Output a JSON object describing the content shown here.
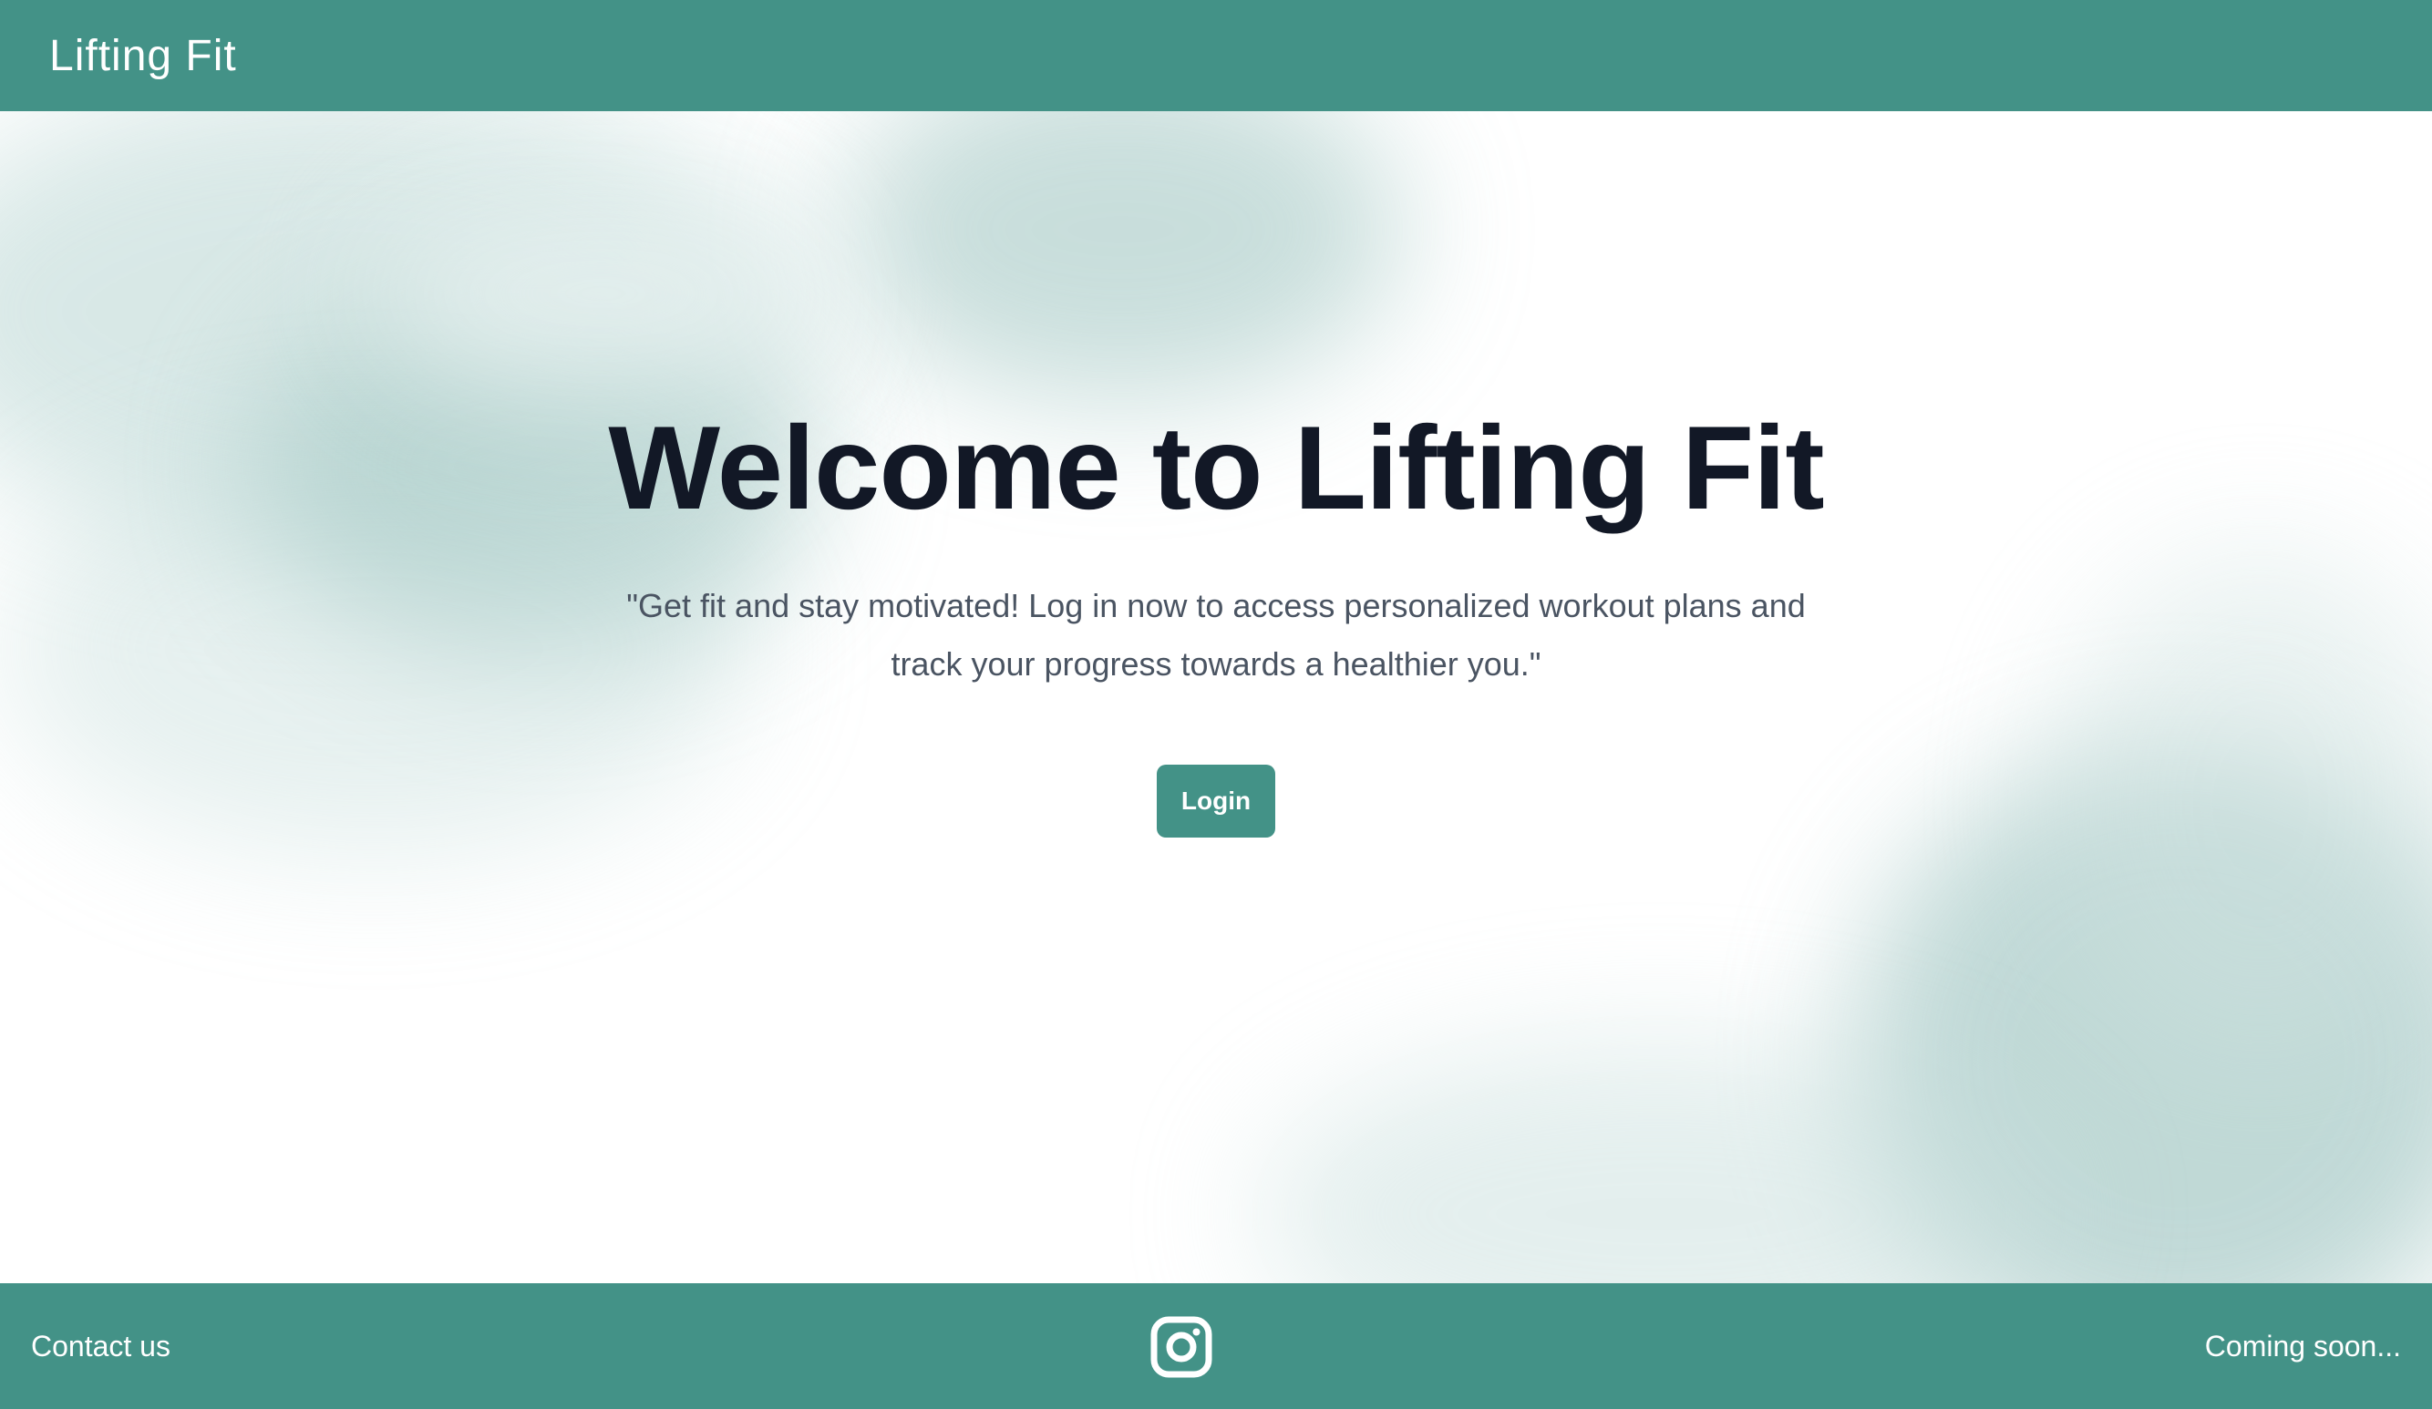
{
  "header": {
    "brand": "Lifting Fit"
  },
  "hero": {
    "title": "Welcome to Lifting Fit",
    "subtitle": "\"Get fit and stay motivated! Log in now to access personalized workout plans and track your progress towards a healthier you.\"",
    "login_label": "Login"
  },
  "footer": {
    "contact_label": "Contact us",
    "social_icon": "instagram-icon",
    "coming_soon_label": "Coming soon..."
  },
  "colors": {
    "primary": "#439287",
    "title_text": "#121826",
    "body_text": "#4a5462",
    "background": "#ffffff"
  }
}
